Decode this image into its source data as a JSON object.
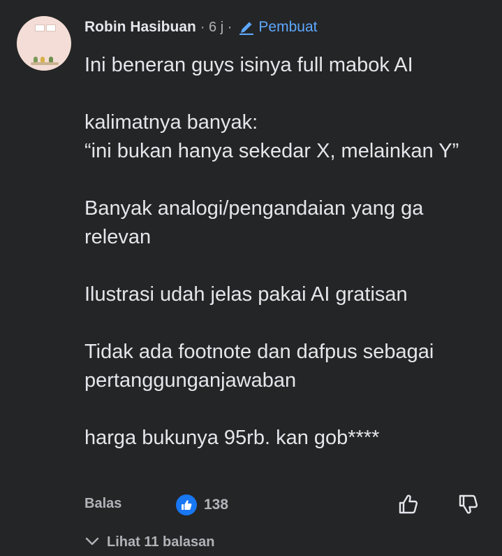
{
  "comment": {
    "author": "Robin Hasibuan",
    "time": "· 6 j ·",
    "creator_badge": "Pembuat",
    "paragraphs": [
      "Ini beneran guys isinya full mabok AI",
      "kalimatnya banyak:\n“ini bukan hanya sekedar X, melainkan Y”",
      "Banyak analogi/pengandaian yang ga relevan",
      "Ilustrasi udah jelas pakai AI gratisan",
      "Tidak ada footnote dan dafpus sebagai pertanggunganjawaban",
      "harga bukunya 95rb. kan gob****"
    ]
  },
  "actions": {
    "reply_label": "Balas",
    "like_count": "138",
    "like_icon": "thumbs-up-icon",
    "upvote_icon": "thumb-up-outline-icon",
    "downvote_icon": "thumb-down-outline-icon"
  },
  "replies": {
    "label": "Lihat 11 balasan",
    "icon": "chevron-down-icon"
  },
  "colors": {
    "background": "#242526",
    "text": "#e4e6eb",
    "muted": "#b0b3b8",
    "accent": "#5ea8ff",
    "like_blue": "#1877f2"
  }
}
